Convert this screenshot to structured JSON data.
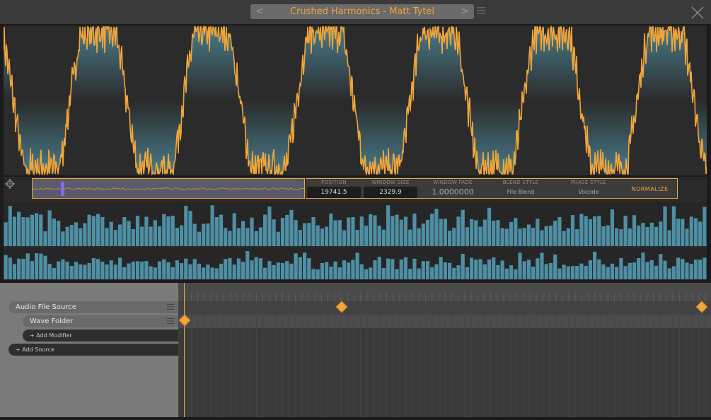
{
  "header": {
    "preset_title": "Crushed Harmonics  -  Matt Tytel",
    "prev_glyph": "<",
    "next_glyph": ">"
  },
  "colors": {
    "accent": "#f2a63a",
    "wave_fill": "#4e8a9c",
    "spectrum_bar": "#4e8fa4",
    "playhead": "#f2a63a"
  },
  "controls": {
    "position": {
      "label": "POSITION",
      "value": "19741.5"
    },
    "window_size": {
      "label": "WINDOW SIZE",
      "value": "2329.9"
    },
    "window_fade": {
      "label": "WINDOW FADE",
      "value": "1.0000000"
    },
    "blend_style": {
      "label": "BLEND STYLE",
      "value": "File Blend"
    },
    "phase_style": {
      "label": "PHASE STYLE",
      "value": "Vocode"
    },
    "normalize_label": "NORMALIZE"
  },
  "modulation": {
    "sources": [
      {
        "label": "Audio File Source",
        "icon": "hamburger-menu-icon"
      },
      {
        "label": "Wave Folder",
        "icon": "hamburger-menu-icon"
      }
    ],
    "add_modifier_label": "+  Add Modifier",
    "add_source_label": "+  Add Source"
  },
  "icons": [
    "left-arrow-icon",
    "right-arrow-icon",
    "hamburger-menu-icon",
    "close-icon",
    "gear-icon",
    "keyframe-diamond-icon"
  ]
}
